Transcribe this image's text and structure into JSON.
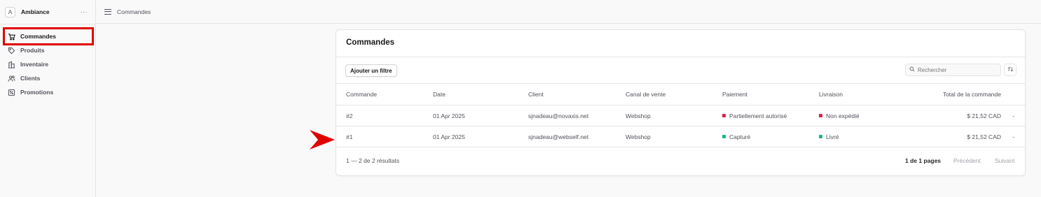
{
  "sidebar": {
    "store_initial": "A",
    "store_name": "Ambiance",
    "more_icon": "···",
    "items": [
      {
        "label": "Commandes",
        "icon": "cart-icon"
      },
      {
        "label": "Produits",
        "icon": "tag-icon"
      },
      {
        "label": "Inventaire",
        "icon": "building-icon"
      },
      {
        "label": "Clients",
        "icon": "users-icon"
      },
      {
        "label": "Promotions",
        "icon": "percent-icon"
      }
    ]
  },
  "topbar": {
    "breadcrumb": "Commandes"
  },
  "orders": {
    "title": "Commandes",
    "add_filter_label": "Ajouter un filtre",
    "search_placeholder": "Rechercher",
    "columns": [
      "Commande",
      "Date",
      "Client",
      "Canal de vente",
      "Paiement",
      "Livraison",
      "Total de la commande"
    ],
    "rows": [
      {
        "id": "#2",
        "date": "01 Apr 2025",
        "client": "sjnadeau@novaxis.net",
        "channel": "Webshop",
        "payment": "Partiellement autorisé",
        "payment_color": "#e11d48",
        "delivery": "Non expédié",
        "delivery_color": "#e11d48",
        "total": "$ 21,52 CAD",
        "menu": "-"
      },
      {
        "id": "#1",
        "date": "01 Apr 2025",
        "client": "sjnadeau@webself.net",
        "channel": "Webshop",
        "payment": "Capturé",
        "payment_color": "#10b981",
        "delivery": "Livré",
        "delivery_color": "#10b981",
        "total": "$ 21,52 CAD",
        "menu": "-"
      }
    ],
    "results_label": "1 — 2 de 2 résultats",
    "pages_label": "1 de 1 pages",
    "prev_label": "Précédent",
    "next_label": "Suivant"
  },
  "annotation": {
    "highlight_color": "#e00000",
    "arrow_color": "#e00000"
  }
}
